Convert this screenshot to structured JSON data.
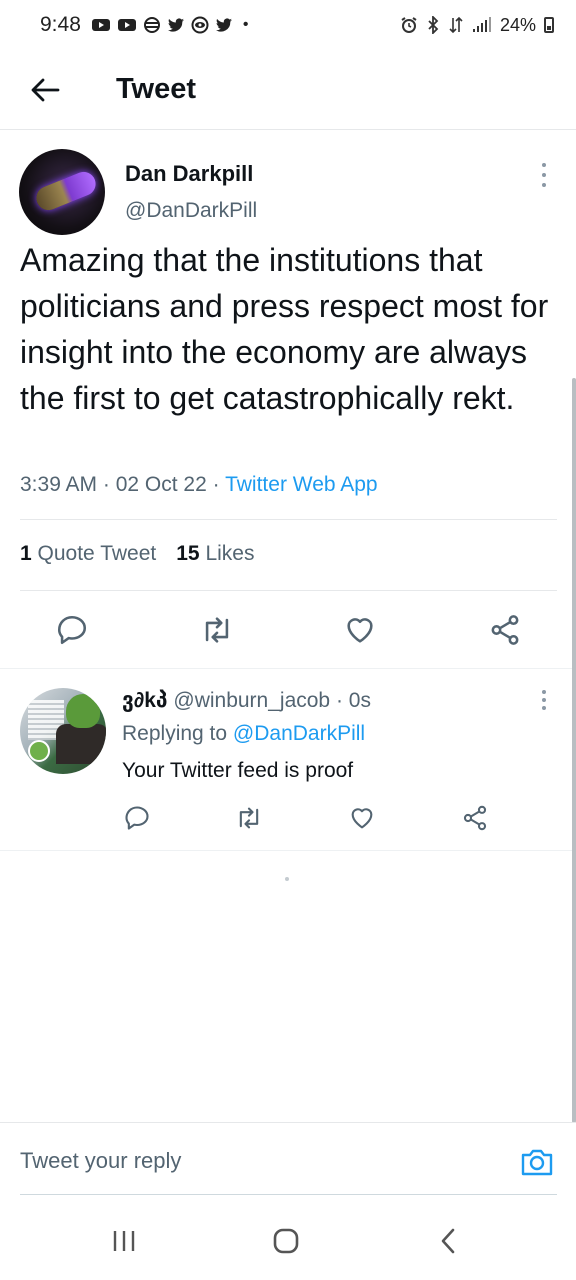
{
  "status_bar": {
    "time": "9:48",
    "notification_icons": [
      "youtube-icon",
      "youtube-icon",
      "tor-icon",
      "twitter-icon",
      "eye-icon",
      "twitter-icon"
    ],
    "battery_percent": "24%"
  },
  "header": {
    "title": "Tweet"
  },
  "tweet": {
    "author_name": "Dan Darkpill",
    "author_handle": "@DanDarkPill",
    "text": "Amazing that the institutions that politicians and press respect most for insight into the economy are always the first to get catastrophically rekt.",
    "time": "3:39 AM",
    "date": "02 Oct 22",
    "source": "Twitter Web App",
    "quote_count": "1",
    "quote_label": "Quote Tweet",
    "like_count": "15",
    "like_label": "Likes"
  },
  "reply": {
    "name": "ვ∂kპ",
    "handle": "@winburn_jacob",
    "age": "0s",
    "replying_label": "Replying to",
    "replying_to": "@DanDarkPill",
    "text": "Your Twitter feed is proof"
  },
  "composer": {
    "placeholder": "Tweet your reply"
  },
  "colors": {
    "accent": "#1d9bf0",
    "secondary_text": "#536471",
    "primary_text": "#0f1419"
  }
}
